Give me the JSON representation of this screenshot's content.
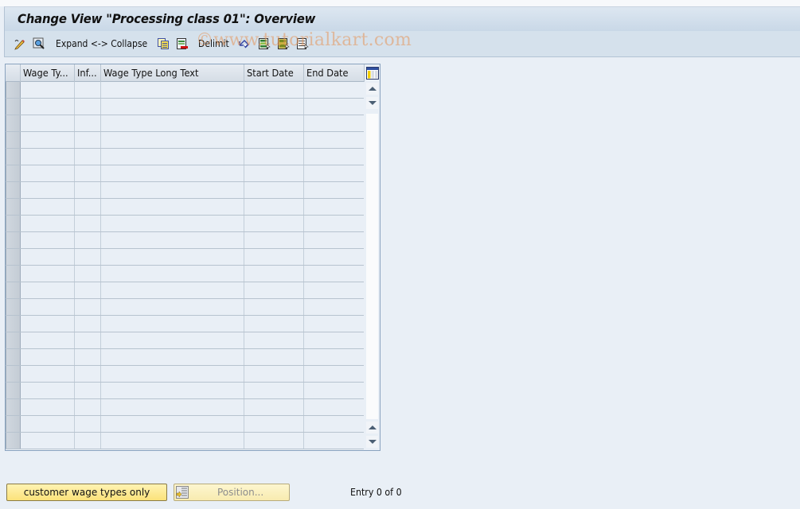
{
  "window": {
    "title": "Change View \"Processing class 01\": Overview"
  },
  "toolbar": {
    "items": [
      {
        "type": "icon",
        "icon": "display-change-icon"
      },
      {
        "type": "icon",
        "icon": "find-icon"
      },
      {
        "type": "text",
        "label": "Expand <-> Collapse"
      },
      {
        "type": "icon",
        "icon": "copy-as-icon"
      },
      {
        "type": "icon",
        "icon": "delete-icon"
      },
      {
        "type": "text",
        "label": "Delimit"
      },
      {
        "type": "icon",
        "icon": "undo-change-icon"
      },
      {
        "type": "icon",
        "icon": "select-all-icon"
      },
      {
        "type": "icon",
        "icon": "select-block-icon"
      },
      {
        "type": "icon",
        "icon": "deselect-all-icon"
      }
    ],
    "expand_collapse_label": "Expand <-> Collapse",
    "delimit_label": "Delimit"
  },
  "watermark": "©www.tutorialkart.com",
  "table": {
    "columns": [
      {
        "label": "Wage Ty..."
      },
      {
        "label": "Inf..."
      },
      {
        "label": "Wage Type Long Text"
      },
      {
        "label": "Start Date"
      },
      {
        "label": "End Date"
      }
    ],
    "row_count_visible": 22,
    "rows": []
  },
  "footer": {
    "customer_button_label": "customer wage types only",
    "position_button_label": "Position...",
    "entry_text": "Entry 0 of 0"
  }
}
